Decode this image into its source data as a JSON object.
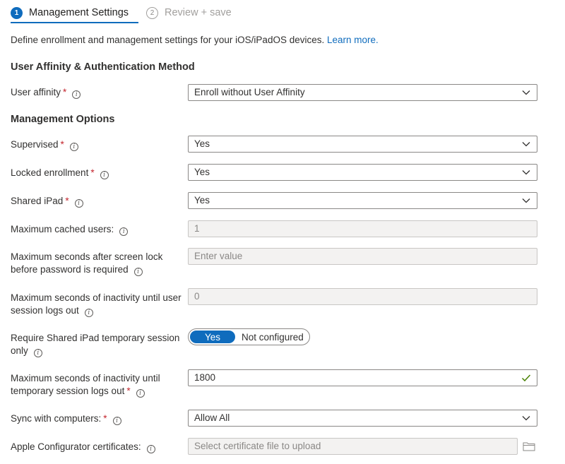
{
  "wizard": {
    "steps": [
      {
        "number": "1",
        "label": "Management Settings"
      },
      {
        "number": "2",
        "label": "Review + save"
      }
    ]
  },
  "intro": {
    "text": "Define enrollment and management settings for your iOS/iPadOS devices.",
    "link": "Learn more."
  },
  "sections": {
    "auth": "User Affinity & Authentication Method",
    "management": "Management Options"
  },
  "required_marker": "*",
  "info_glyph": "i",
  "fields": {
    "user_affinity": {
      "label": "User affinity",
      "value": "Enroll without User Affinity"
    },
    "supervised": {
      "label": "Supervised",
      "value": "Yes"
    },
    "locked_enrollment": {
      "label": "Locked enrollment",
      "value": "Yes"
    },
    "shared_ipad": {
      "label": "Shared iPad",
      "value": "Yes"
    },
    "max_cached_users": {
      "label": "Maximum cached users:",
      "value": "1"
    },
    "max_seconds_screen_lock": {
      "label": "Maximum seconds after screen lock before password is required",
      "placeholder": "Enter value"
    },
    "max_seconds_user_session": {
      "label": "Maximum seconds of inactivity until user session logs out",
      "value": "0"
    },
    "require_temp_session": {
      "label": "Require Shared iPad temporary session only",
      "on_label": "Yes",
      "off_label": "Not configured",
      "selected": "Yes"
    },
    "max_seconds_temp_session": {
      "label": "Maximum seconds of inactivity until temporary session logs out",
      "value": "1800"
    },
    "sync_with_computers": {
      "label": "Sync with computers:",
      "value": "Allow All"
    },
    "apple_configurator": {
      "label": "Apple Configurator certificates:",
      "placeholder": "Select certificate file to upload"
    }
  },
  "colors": {
    "accent": "#0f6cbd",
    "required": "#c4262e",
    "valid_check": "#498205"
  }
}
